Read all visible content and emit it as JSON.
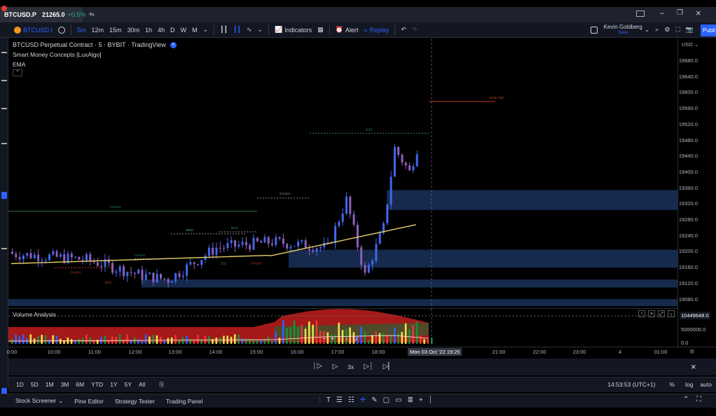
{
  "tab": {
    "symbol": "BTCUSD.P",
    "price": "21265.0",
    "change": "+0.5%",
    "close": "×",
    "new_tab": "+"
  },
  "window": {
    "minimize": "–",
    "restore": "❐",
    "close": "×"
  },
  "toolbar": {
    "symbol": "BTCUSD.I",
    "intervals": [
      "5m",
      "12m",
      "15m",
      "30m",
      "1h",
      "4h",
      "D",
      "W",
      "M"
    ],
    "active_interval": "5m",
    "indicators": "Indicators",
    "alert": "Alert",
    "replay": "Replay",
    "user_name": "Kevin Goldberg",
    "user_status": "Save",
    "publish": "Publi"
  },
  "chart": {
    "title": "BTCUSD Perpetual Contract · 5 · BYBIT · TradingView",
    "indicator_1": "Smart Money Concepts [LuxAlgo]",
    "indicator_2": "EMA",
    "currency": "USD",
    "volume_label": "Volume Analysis",
    "volume_value": "10449648.0",
    "smc_labels": {
      "weak_high": "Weak High",
      "choch_left": "CHoCH",
      "choch_mid": "CHoCH",
      "bos_1": "BOS",
      "bos_2": "BOS",
      "bos_3": "BOS",
      "bos_top": "BOS",
      "choch_low": "CHoCH",
      "eql": "EQL",
      "choch_red": "CHoCH",
      "bos_red": "BOS"
    }
  },
  "price_axis": [
    "19680.0",
    "19640.0",
    "19600.0",
    "19560.0",
    "19520.0",
    "19480.0",
    "19440.0",
    "19400.0",
    "19360.0",
    "19320.0",
    "19280.0",
    "19240.0",
    "19200.0",
    "19160.0",
    "19120.0",
    "19080.0"
  ],
  "vol_axis": [
    "5000000.0",
    "0.0"
  ],
  "time_axis": [
    "0:00",
    "10:00",
    "11:00",
    "12:00",
    "13:00",
    "14:00",
    "15:00",
    "16:00",
    "17:00",
    "18:00",
    "21:00",
    "22:00",
    "23:00",
    "4",
    "01:00"
  ],
  "cursor_time": "Mon 03 Oct '22  19:25",
  "replay": {
    "speed": "3x"
  },
  "ranges": [
    "1D",
    "5D",
    "1M",
    "3M",
    "6M",
    "YTD",
    "1Y",
    "5Y",
    "All"
  ],
  "status": {
    "clock": "14:53:53 (UTC+1)",
    "percent": "%",
    "log": "log",
    "auto": "auto"
  },
  "bottom_tabs": [
    "Stock Screener",
    "Pine Editor",
    "Strategy Tester",
    "Trading Panel"
  ],
  "colors": {
    "bull": "#3f68f0",
    "bear": "#8e5fb8",
    "ema": "#e8d06a",
    "zone": "#162a4e",
    "accent": "#2962ff"
  }
}
